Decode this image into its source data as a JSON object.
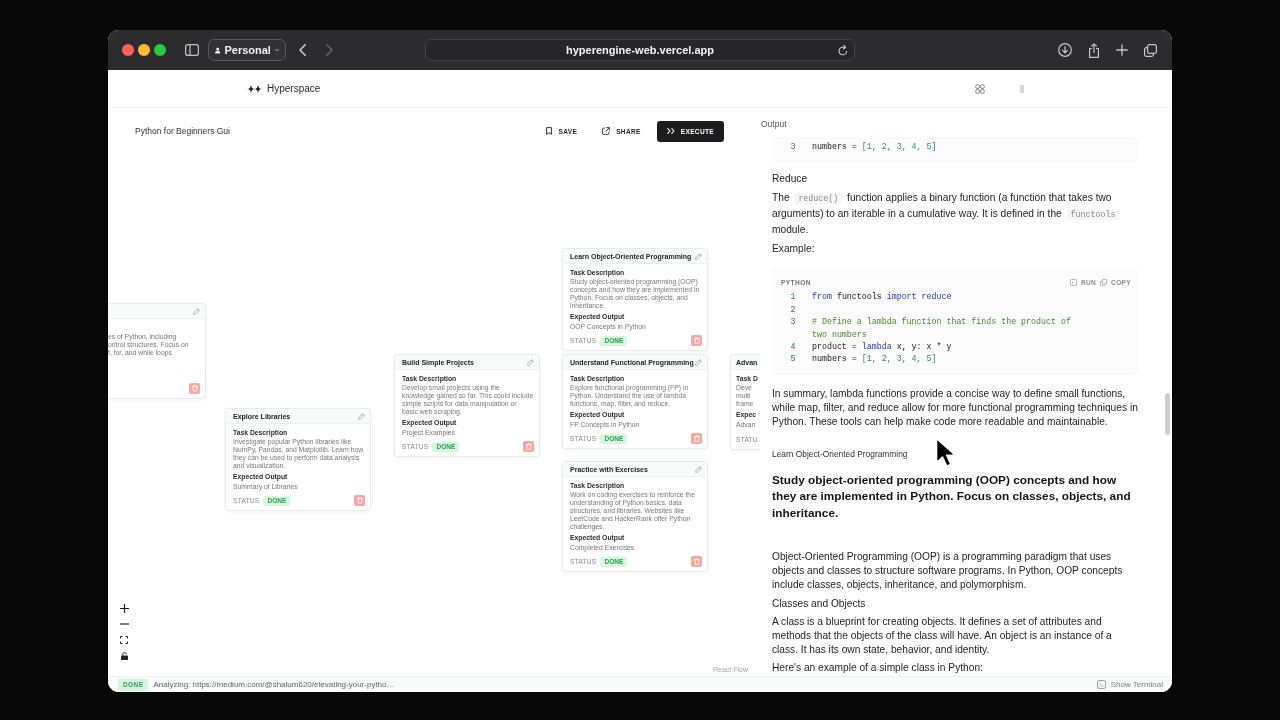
{
  "browser": {
    "profile": "Personal",
    "back_disabled": false,
    "forward_disabled": true,
    "url": "hyperengine-web.vercel.app"
  },
  "app": {
    "brand": "Hyperspace"
  },
  "flow": {
    "title": "Python for Beginners Gui",
    "actions": [
      {
        "kind": "save",
        "label": "SAVE"
      },
      {
        "kind": "share",
        "label": "SHARE"
      },
      {
        "kind": "execute",
        "label": "EXECUTE"
      }
    ],
    "nodes": [
      {
        "kind": "cut-left",
        "description_lines": [
          "es of Python, including",
          "ontrol structures. Focus on",
          "f, for, and while loops"
        ]
      },
      {
        "kind": "full",
        "title": "Explore Libraries",
        "description_label": "Task Description",
        "description": "Investigate popular Python libraries like NumPy, Pandas, and Matplotlib. Learn how they can be used to perform data analysis and visualization.",
        "output_label": "Expected Output",
        "output": "Summary of Libraries",
        "status_label": "STATUS",
        "status": "DONE"
      },
      {
        "kind": "full",
        "title": "Build Simple Projects",
        "description_label": "Task Description",
        "description": "Develop small projects using the knowledge gained so far. This could include simple scripts for data manipulation or basic web scraping.",
        "output_label": "Expected Output",
        "output": "Project Examples",
        "status_label": "STATUS",
        "status": "DONE"
      },
      {
        "kind": "full",
        "title": "Learn Object-Oriented Programming",
        "description_label": "Task Description",
        "description": "Study object-oriented programming (OOP) concepts and how they are implemented in Python. Focus on classes, objects, and inheritance.",
        "output_label": "Expected Output",
        "output": "OOP Concepts in Python",
        "status_label": "STATUS",
        "status": "DONE"
      },
      {
        "kind": "full",
        "title": "Understand Functional Programming",
        "description_label": "Task Description",
        "description": "Explore functional programming (FP) in Python. Understand the use of lambda functions, map, filter, and reduce.",
        "output_label": "Expected Output",
        "output": "FP Concepts in Python",
        "status_label": "STATUS",
        "status": "DONE"
      },
      {
        "kind": "full",
        "title": "Practice with Exercises",
        "description_label": "Task Description",
        "description": "Work on coding exercises to reinforce the understanding of Python basics, data structures, and libraries. Websites like LeetCode and HackerRank offer Python challenges.",
        "output_label": "Expected Output",
        "output": "Completed Exercises",
        "status_label": "STATUS",
        "status": "DONE"
      },
      {
        "kind": "cut-right",
        "title": "Advan",
        "description_label": "Task D",
        "description_lines": [
          "Deve",
          "multi",
          "frame"
        ],
        "output_label": "Expec",
        "output": "Advan",
        "status_label": "STATU"
      }
    ],
    "attribution": "React Flow"
  },
  "output": {
    "label": "Output",
    "blocks": [
      {
        "kind": "code",
        "lines": [
          {
            "number": "3",
            "tokens": [
              {
                "kind": "plain",
                "text": "numbers = "
              },
              {
                "kind": "number",
                "text": "[1, 2, 3, 4, 5]"
              }
            ]
          }
        ]
      },
      {
        "kind": "heading",
        "text": "Reduce"
      },
      {
        "kind": "paragraph",
        "parts": [
          {
            "kind": "text",
            "text": "The "
          },
          {
            "kind": "code",
            "text": "reduce()"
          },
          {
            "kind": "text",
            "text": " function applies a binary function (a function that takes two arguments) to an iterable in a cumulative way. It is defined in the "
          },
          {
            "kind": "code",
            "text": "functools"
          },
          {
            "kind": "text",
            "text": " module."
          }
        ]
      },
      {
        "kind": "paragraph",
        "text": "Example:"
      },
      {
        "kind": "code",
        "language": "PYTHON",
        "actions": [
          {
            "kind": "run",
            "label": "RUN"
          },
          {
            "kind": "copy",
            "label": "COPY"
          }
        ],
        "lines": [
          {
            "number": "1",
            "tokens": [
              {
                "kind": "keyword",
                "text": "from"
              },
              {
                "kind": "plain",
                "text": " functools "
              },
              {
                "kind": "keyword",
                "text": "import reduce"
              }
            ]
          },
          {
            "number": "2"
          },
          {
            "number": "3",
            "tokens": [
              {
                "kind": "comment",
                "text": "# Define a lambda function that finds the product of two numbers"
              }
            ]
          },
          {
            "number": "4",
            "tokens": [
              {
                "kind": "plain",
                "text": "product = "
              },
              {
                "kind": "keyword",
                "text": "lambda"
              },
              {
                "kind": "plain",
                "text": " x, y: x * y"
              }
            ]
          },
          {
            "number": "5",
            "tokens": [
              {
                "kind": "plain",
                "text": "numbers = "
              },
              {
                "kind": "number",
                "text": "[1, 2, 3, 4, 5]"
              }
            ]
          }
        ]
      },
      {
        "kind": "paragraph",
        "text": "In summary, lambda functions provide a concise way to define small functions, while map, filter, and reduce allow for more functional programming techniques in Python. These tools can help make code more readable and maintainable."
      },
      {
        "kind": "task-label",
        "text": "Learn Object-Oriented Programming"
      },
      {
        "kind": "task-title",
        "text": "Study object-oriented programming (OOP) concepts and how they are implemented in Python. Focus on classes, objects, and inheritance."
      },
      {
        "kind": "paragraph",
        "text": "Object-Oriented Programming (OOP) is a programming paradigm that uses objects and classes to structure software programs. In Python, OOP concepts include classes, objects, inheritance, and polymorphism."
      },
      {
        "kind": "heading",
        "text": "Classes and Objects"
      },
      {
        "kind": "paragraph",
        "text": "A class is a blueprint for creating objects. It defines a set of attributes and methods that the objects of the class will have. An object is an instance of a class. It has its own state, behavior, and identity."
      },
      {
        "kind": "paragraph",
        "text": "Here's an example of a simple class in Python:"
      }
    ]
  },
  "status_bar": {
    "state": "DONE",
    "message": "Analyzing: https://medium.com/@shalum620/elevating-your-pytho…",
    "terminal_button": "Show Terminal"
  }
}
